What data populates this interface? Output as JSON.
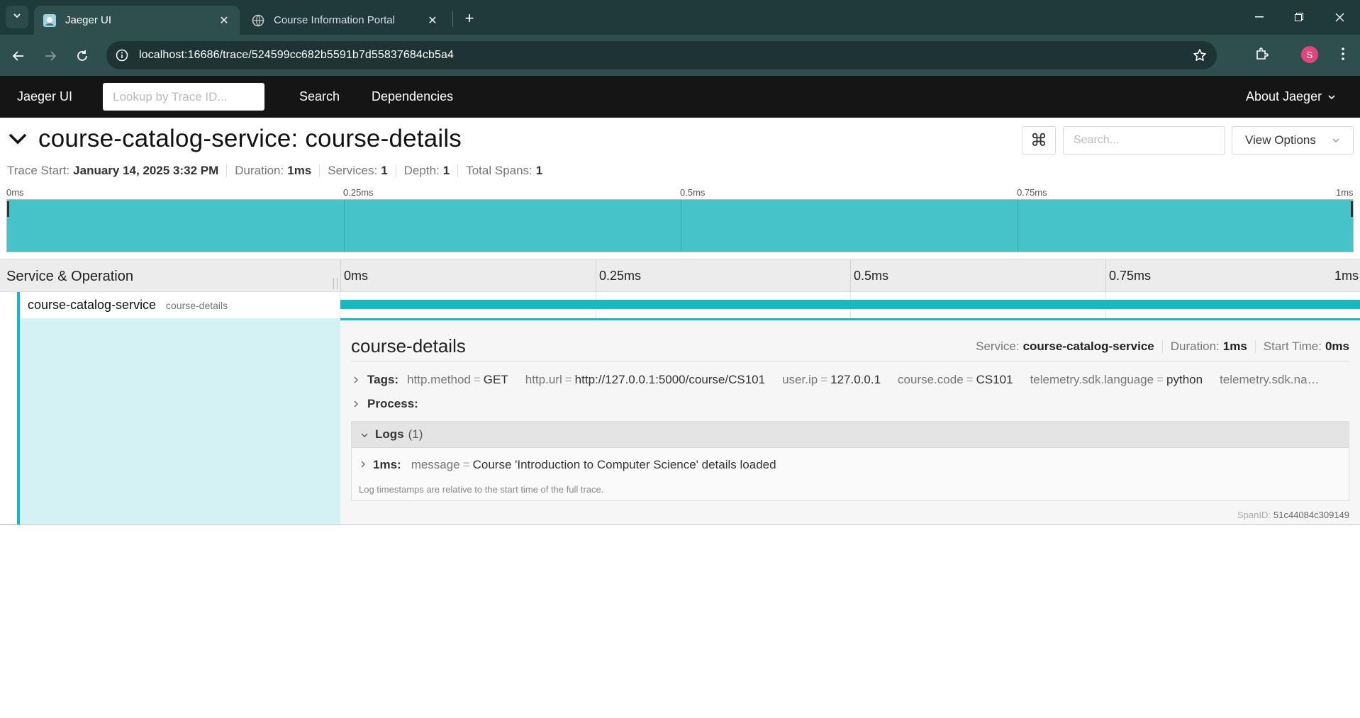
{
  "browser": {
    "tabs": [
      {
        "title": "Jaeger UI",
        "active": true,
        "icon": "jaeger-favicon"
      },
      {
        "title": "Course Information Portal",
        "active": false,
        "icon": "globe-icon"
      }
    ],
    "url": "localhost:16686/trace/524599cc682b5591b7d55837684cb5a4",
    "profile_initial": "S",
    "accent": "#2f4f4f"
  },
  "nav": {
    "brand": "Jaeger UI",
    "lookup_placeholder": "Lookup by Trace ID...",
    "search": "Search",
    "dependencies": "Dependencies",
    "about": "About Jaeger"
  },
  "trace": {
    "title": "course-catalog-service: course-details",
    "search_placeholder": "Search...",
    "view_options": "View Options",
    "meta": {
      "start_label": "Trace Start:",
      "start": "January 14, 2025 3:32 PM",
      "duration_label": "Duration:",
      "duration": "1ms",
      "services_label": "Services:",
      "services": "1",
      "depth_label": "Depth:",
      "depth": "1",
      "spans_label": "Total Spans:",
      "spans": "1"
    },
    "ticks": [
      "0ms",
      "0.25ms",
      "0.5ms",
      "0.75ms",
      "1ms"
    ]
  },
  "timeline": {
    "header_label": "Service & Operation",
    "ticks": [
      "0ms",
      "0.25ms",
      "0.5ms",
      "0.75ms",
      "1ms"
    ]
  },
  "span": {
    "service": "course-catalog-service",
    "operation": "course-details",
    "color": "#17b8be",
    "detail": {
      "title": "course-details",
      "service_label": "Service:",
      "service": "course-catalog-service",
      "duration_label": "Duration:",
      "duration": "1ms",
      "start_label": "Start Time:",
      "start": "0ms",
      "tags_label": "Tags:",
      "tags": [
        {
          "k": "http.method",
          "v": "GET"
        },
        {
          "k": "http.url",
          "v": "http://127.0.0.1:5000/course/CS101"
        },
        {
          "k": "user.ip",
          "v": "127.0.0.1"
        },
        {
          "k": "course.code",
          "v": "CS101"
        },
        {
          "k": "telemetry.sdk.language",
          "v": "python"
        },
        {
          "k": "telemetry.sdk.na…",
          "v": ""
        }
      ],
      "process_label": "Process:",
      "logs_label": "Logs",
      "logs_count": "(1)",
      "log": {
        "ts": "1ms:",
        "k": "message",
        "v": "Course 'Introduction to Computer Science' details loaded"
      },
      "logs_note": "Log timestamps are relative to the start time of the full trace.",
      "spanid_label": "SpanID:",
      "spanid": "51c44084c309149"
    }
  }
}
